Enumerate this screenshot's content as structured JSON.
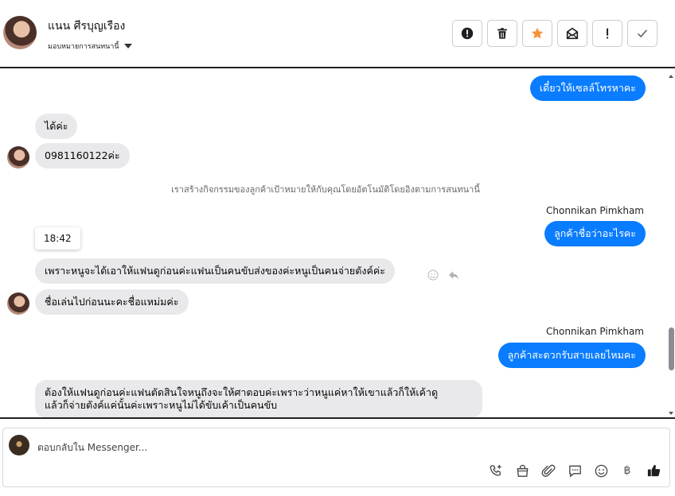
{
  "header": {
    "contact_name": "แนน ศีรบุญเรือง",
    "assign_label": "มอบหมายการสนทนานี้",
    "actions": [
      {
        "name": "spam",
        "icon": "alert-circle-icon"
      },
      {
        "name": "delete",
        "icon": "trash-icon"
      },
      {
        "name": "star",
        "icon": "star-icon"
      },
      {
        "name": "mark-unread",
        "icon": "envelope-icon"
      },
      {
        "name": "follow-up",
        "icon": "exclamation-icon"
      },
      {
        "name": "done",
        "icon": "check-icon"
      }
    ]
  },
  "messages": {
    "m1": {
      "text": "เดี๋ยวให้เซลล์โทรหาคะ"
    },
    "m2": {
      "text": "ได้ค่ะ"
    },
    "m3": {
      "text": "0981160122ค่ะ"
    },
    "system_note": "เราสร้างกิจกรรมของลูกค้าเป้าหมายให้กับคุณโดยอัตโนมัติโดยอิงตามการสนทนานี้",
    "sender_a": "Chonnikan Pimkham",
    "m4": {
      "text": "ลูกค้าชื่อว่าอะไรคะ"
    },
    "time_chip": "18:42",
    "m5": {
      "text": "เพราะหนูจะได้เอาให้แฟนดูก่อนค่ะแฟนเป็นคนขับส่งของค่ะหนูเป็นคนจ่ายตังค์ค่ะ"
    },
    "m6": {
      "text": "ชื่อเล่นไปก่อนนะคะชื่อแหม่มค่ะ"
    },
    "sender_b": "Chonnikan Pimkham",
    "m7": {
      "text": "ลูกค้าสะดวกรับสายเลยไหมคะ"
    },
    "m8": {
      "line1": "ต้องให้แฟนดูก่อนค่ะแฟนตัดสินใจหนูถึงจะให้ศาตอบค่ะเพราะว่าหนูแค่หาให้เขาแล้วก็ให้เค้าดู",
      "line2": "แล้วก็จ่ายตังค์แค่นั้นค่ะเพราะหนูไม่ได้ขับเค้าเป็นคนขับ"
    }
  },
  "composer": {
    "placeholder": "ตอบกลับใน Messenger...",
    "tools": [
      "phone-plus-icon",
      "shopping-bag-icon",
      "paperclip-icon",
      "chat-bubble-icon",
      "smiley-icon",
      "baht-icon",
      "thumbs-up-icon"
    ],
    "baht_symbol": "฿"
  },
  "colors": {
    "outgoing_bubble": "#0a7cff",
    "incoming_bubble": "#e9e9eb",
    "star": "#f5933b"
  }
}
